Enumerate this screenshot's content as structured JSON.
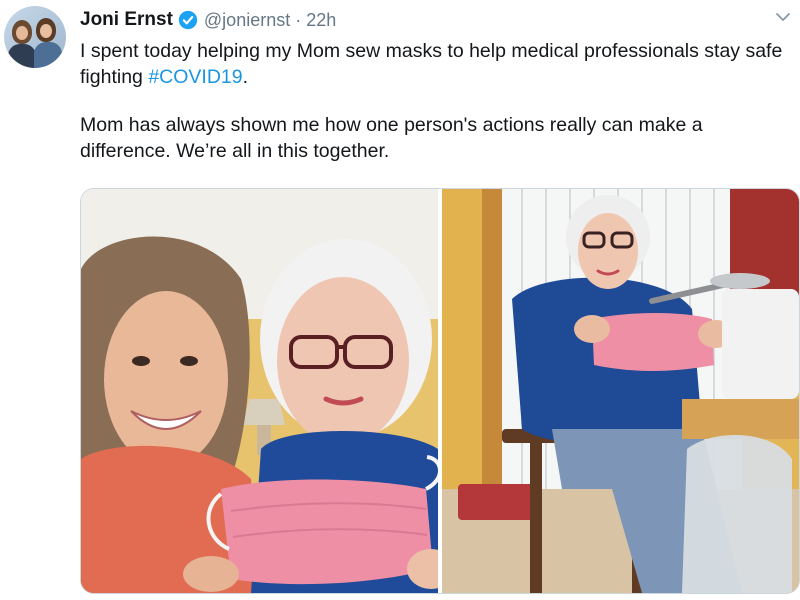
{
  "tweet": {
    "author_name": "Joni Ernst",
    "handle": "@joniernst",
    "separator": "·",
    "time": "22h",
    "paragraph1_text": "I spent today helping my Mom sew masks to help medical professionals stay safe fighting ",
    "hashtag": "#COVID19",
    "paragraph1_end": ".",
    "paragraph2": "Mom has always shown me how one person's actions really can make a difference. We’re all in this together."
  },
  "icons": {
    "verified": "verified-badge-icon",
    "menu": "chevron-down-icon"
  },
  "colors": {
    "link": "#1b95e0",
    "secondary_text": "#657786",
    "primary_text": "#14171a",
    "verified": "#1da1f2"
  }
}
